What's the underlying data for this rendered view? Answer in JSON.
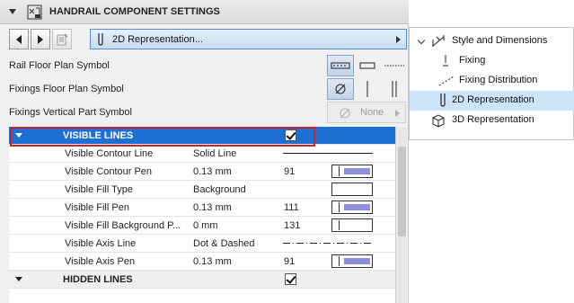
{
  "header": {
    "title": "HANDRAIL COMPONENT SETTINGS"
  },
  "nav": {
    "dropdown_value": "2D Representation..."
  },
  "symbols": [
    {
      "label": "Rail Floor Plan Symbol"
    },
    {
      "label": "Fixings Floor Plan Symbol"
    },
    {
      "label": "Fixings Vertical Part Symbol",
      "value": "None"
    }
  ],
  "sections": [
    {
      "name": "VISIBLE LINES",
      "checked": true,
      "rows": [
        {
          "name": "Visible Contour Line",
          "value": "Solid Line",
          "num": ""
        },
        {
          "name": "Visible Contour Pen",
          "value": "0.13 mm",
          "num": "91"
        },
        {
          "name": "Visible Fill Type",
          "value": "Background",
          "num": ""
        },
        {
          "name": "Visible Fill Pen",
          "value": "0.13 mm",
          "num": "111"
        },
        {
          "name": "Visible Fill Background P...",
          "value": "0 mm",
          "num": "131"
        },
        {
          "name": "Visible Axis Line",
          "value": "Dot & Dashed",
          "num": ""
        },
        {
          "name": "Visible Axis Pen",
          "value": "0.13 mm",
          "num": "91"
        }
      ]
    },
    {
      "name": "HIDDEN LINES",
      "checked": true,
      "rows": []
    }
  ],
  "tree": {
    "items": [
      {
        "label": "Style and Dimensions"
      },
      {
        "label": "Fixing"
      },
      {
        "label": "Fixing Distribution"
      },
      {
        "label": "2D Representation",
        "selected": true
      },
      {
        "label": "3D Representation"
      }
    ]
  },
  "colors": {
    "section_header": "#1e6fd4",
    "selection": "#cde3f7",
    "pen_fill": "#8e8edc",
    "highlight": "#c8242b"
  }
}
